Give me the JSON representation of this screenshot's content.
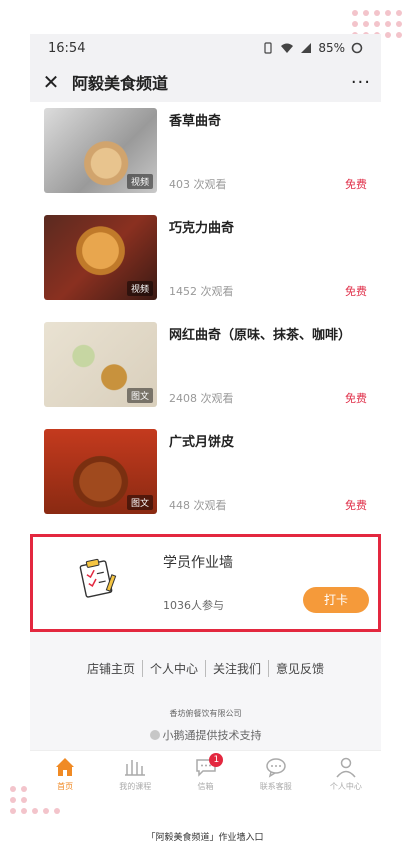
{
  "status_bar": {
    "time": "16:54",
    "battery": "85%"
  },
  "header": {
    "title": "阿毅美食频道"
  },
  "courses": [
    {
      "title": "香草曲奇",
      "views": "403 次观看",
      "price": "免费",
      "tag": "视频"
    },
    {
      "title": "巧克力曲奇",
      "views": "1452 次观看",
      "price": "免费",
      "tag": "视频"
    },
    {
      "title": "网红曲奇（原味、抹茶、咖啡）",
      "views": "2408 次观看",
      "price": "免费",
      "tag": "图文"
    },
    {
      "title": "广式月饼皮",
      "views": "448 次观看",
      "price": "免费",
      "tag": "图文"
    }
  ],
  "homework": {
    "title": "学员作业墙",
    "participants": "1036人参与",
    "button": "打卡"
  },
  "footer": {
    "links": [
      "店铺主页",
      "个人中心",
      "关注我们",
      "意见反馈"
    ],
    "company": "香坊俯餐饮有限公司",
    "support": "小鹅通提供技术支持"
  },
  "tabs": [
    {
      "label": "首页",
      "icon": "home-icon",
      "active": true
    },
    {
      "label": "我的课程",
      "icon": "course-icon"
    },
    {
      "label": "信箱",
      "icon": "message-icon",
      "badge": "1"
    },
    {
      "label": "联系客服",
      "icon": "service-icon"
    },
    {
      "label": "个人中心",
      "icon": "user-icon"
    }
  ],
  "caption": "「阿毅美食频道」作业墙入口",
  "colors": {
    "accent": "#f08a24",
    "price": "#e0304a",
    "highlight_border": "#e3283f",
    "checkin_button": "#f59a3a"
  }
}
